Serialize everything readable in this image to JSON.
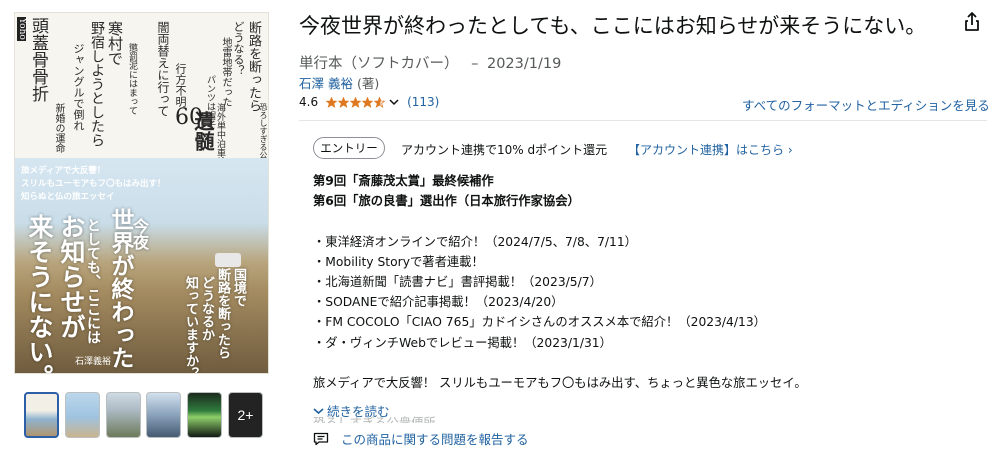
{
  "product": {
    "title": "今夜世界が終わったとしても、ここにはお知らせが来そうにない。",
    "format": "単行本（ソフトカバー）",
    "date_sep": "–",
    "date": "2023/1/19",
    "author": "石澤 義裕",
    "author_role": "(著)",
    "rating_value": "4.6",
    "rating_count": "(113)",
    "rating_stars": 4.6,
    "formats_link": "すべてのフォーマットとエディションを見る"
  },
  "promo": {
    "badge": "エントリー",
    "text": "アカウント連携で10% dポイント還元",
    "link": "【アカウント連携】はこちら ›"
  },
  "description": {
    "award1": "第9回「斎藤茂太賞」最終候補作",
    "award2": "第6回「旅の良書」選出作（日本旅行作家協会）",
    "media": [
      "・東洋経済オンラインで紹介！（2024/7/5、7/8、7/11）",
      "・Mobility Storyで著者連載！",
      "・北海道新聞「読書ナビ」書評掲載！（2023/5/7）",
      "・SODANEで紹介記事掲載！（2023/4/20）",
      "・FM COCOLO「CIAO 765」カドイシさんのオススメ本で紹介！（2023/4/13）",
      "・ダ・ヴィンチWebでレビュー掲載！（2023/1/31）"
    ],
    "blurb": "旅メディアで大反響！ スリルもユーモアもフ〇もはみ出す、ちょっと異色な旅エッセイ。",
    "faded": "恐ろしすぎる公衆便所"
  },
  "actions": {
    "read_more": "続きを読む",
    "report": "この商品に関する問題を報告する"
  },
  "thumbnails": {
    "more_label": "2+"
  },
  "cover": {
    "publisher_mark": "Yoho",
    "top_columns": [
      "頭蓋骨骨折",
      "新婚の運命",
      "寒村で",
      "野宿しようとしたら",
      "懲罰泥にはまって",
      "ジャングルで倒れ",
      "闇両替えに行って",
      "行方不明",
      "地雷地帯だった",
      "パンツは帽子",
      "断路を断ったら",
      "どうなる？",
      "海外単中泊車検",
      "遺髄",
      "恐ろしすぎる公衆便所"
    ],
    "number": "60",
    "banner_lines": [
      "旅メディアで大反響！",
      "スリルもユーモアもフ〇もはみ出す！",
      "知らぬと仏の旅エッセイ"
    ],
    "big_title": [
      "今夜",
      "世界が終わった",
      "としても、ここには",
      "お知らせが",
      "来そうにない。"
    ],
    "sub_title": [
      "国境で",
      "断路を断ったら",
      "どうなるか",
      "知っていますか？"
    ],
    "author_on_cover": "石澤義裕",
    "colors": {
      "sky": "#cfe2ee",
      "sand": "#a48b60"
    }
  },
  "colors": {
    "link": "#2162a1",
    "text": "#0f1111",
    "muted": "#565959",
    "star": "#de7921",
    "thumb_selected": "#2d5fa8"
  },
  "icons": [
    "share-icon",
    "star-icon",
    "chevron-down-icon",
    "report-icon"
  ]
}
